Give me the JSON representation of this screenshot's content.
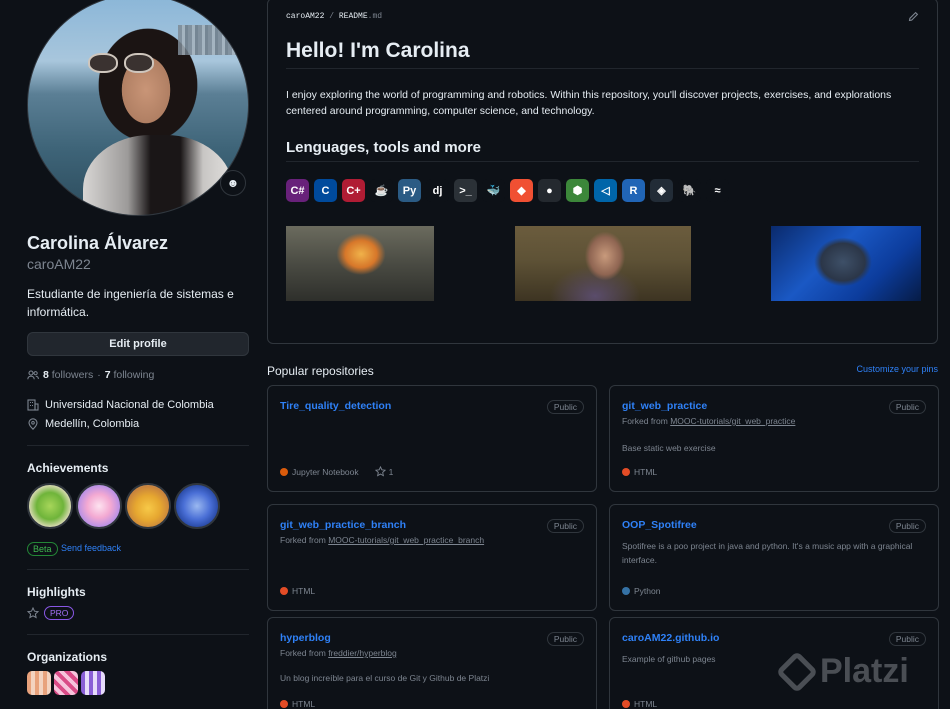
{
  "profile": {
    "name": "Carolina Álvarez",
    "login": "caroAM22",
    "bio": "Estudiante de ingeniería de sistemas e informática.",
    "edit_label": "Edit profile",
    "followers_count": "8",
    "followers_label": "followers",
    "separator": "·",
    "following_count": "7",
    "following_label": "following",
    "organization_company": "Universidad Nacional de Colombia",
    "location": "Medellín, Colombia"
  },
  "achievements": {
    "title": "Achievements",
    "beta_label": "Beta",
    "feedback_label": "Send feedback"
  },
  "highlights": {
    "title": "Highlights",
    "pro_label": "PRO"
  },
  "organizations": {
    "title": "Organizations"
  },
  "readme": {
    "breadcrumb_user": "caroAM22",
    "breadcrumb_sep": "/",
    "breadcrumb_file": "README",
    "breadcrumb_ext": ".md",
    "heading": "Hello! I'm Carolina",
    "intro": "I enjoy exploring the world of programming and robotics. Within this repository, you'll discover projects, exercises, and explorations centered around programming, computer science, and technology.",
    "subheading": "Lenguages, tools and more",
    "tools": [
      {
        "icon": "csharp-icon",
        "glyph": "C#",
        "color": "#68217a"
      },
      {
        "icon": "c-icon",
        "glyph": "C",
        "color": "#004a9c"
      },
      {
        "icon": "cplusplus-icon",
        "glyph": "C+",
        "color": "#b01c34"
      },
      {
        "icon": "java-icon",
        "glyph": "☕",
        "color": "#0d1117"
      },
      {
        "icon": "python-icon",
        "glyph": "Py",
        "color": "#2b5b84"
      },
      {
        "icon": "django-icon",
        "glyph": "dj",
        "color": "#0d1117"
      },
      {
        "icon": "bash-icon",
        "glyph": ">_",
        "color": "#2b3137"
      },
      {
        "icon": "docker-icon",
        "glyph": "🐳",
        "color": "#0d1117"
      },
      {
        "icon": "git-icon",
        "glyph": "◆",
        "color": "#f05033"
      },
      {
        "icon": "github-icon",
        "glyph": "●",
        "color": "#24292f"
      },
      {
        "icon": "nodejs-icon",
        "glyph": "⬢",
        "color": "#3c873a"
      },
      {
        "icon": "vscode-icon",
        "glyph": "◁",
        "color": "#0065a9"
      },
      {
        "icon": "r-icon",
        "glyph": "R",
        "color": "#2165b6"
      },
      {
        "icon": "unity-icon",
        "glyph": "◈",
        "color": "#222c37"
      },
      {
        "icon": "postgresql-icon",
        "glyph": "🐘",
        "color": "#0d1117"
      },
      {
        "icon": "mysql-icon",
        "glyph": "≈",
        "color": "#0d1117"
      }
    ]
  },
  "popular": {
    "title": "Popular repositories",
    "customize_label": "Customize your pins",
    "public_label": "Public",
    "forked_prefix": "Forked from",
    "repos": [
      {
        "name": "Tire_quality_detection",
        "fork": "",
        "desc": "",
        "lang": "Jupyter Notebook",
        "lang_color": "#da5b0b",
        "stars": "1"
      },
      {
        "name": "git_web_practice",
        "fork": "MOOC-tutorials/git_web_practice",
        "desc": "Base static web exercise",
        "lang": "HTML",
        "lang_color": "#e34c26",
        "stars": ""
      },
      {
        "name": "git_web_practice_branch",
        "fork": "MOOC-tutorials/git_web_practice_branch",
        "desc": "",
        "lang": "HTML",
        "lang_color": "#e34c26",
        "stars": ""
      },
      {
        "name": "OOP_Spotifree",
        "fork": "",
        "desc": "Spotifree is a poo project in java and python. It's a music app with a graphical interface.",
        "lang": "Python",
        "lang_color": "#3572a5",
        "stars": ""
      },
      {
        "name": "hyperblog",
        "fork": "freddier/hyperblog",
        "desc": "Un blog increíble para el curso de Git y Github de Platzi",
        "lang": "HTML",
        "lang_color": "#e34c26",
        "stars": ""
      },
      {
        "name": "caroAM22.github.io",
        "fork": "",
        "desc": "Example of github pages",
        "lang": "HTML",
        "lang_color": "#e34c26",
        "stars": ""
      }
    ]
  },
  "watermark": {
    "text": "Platzi"
  }
}
